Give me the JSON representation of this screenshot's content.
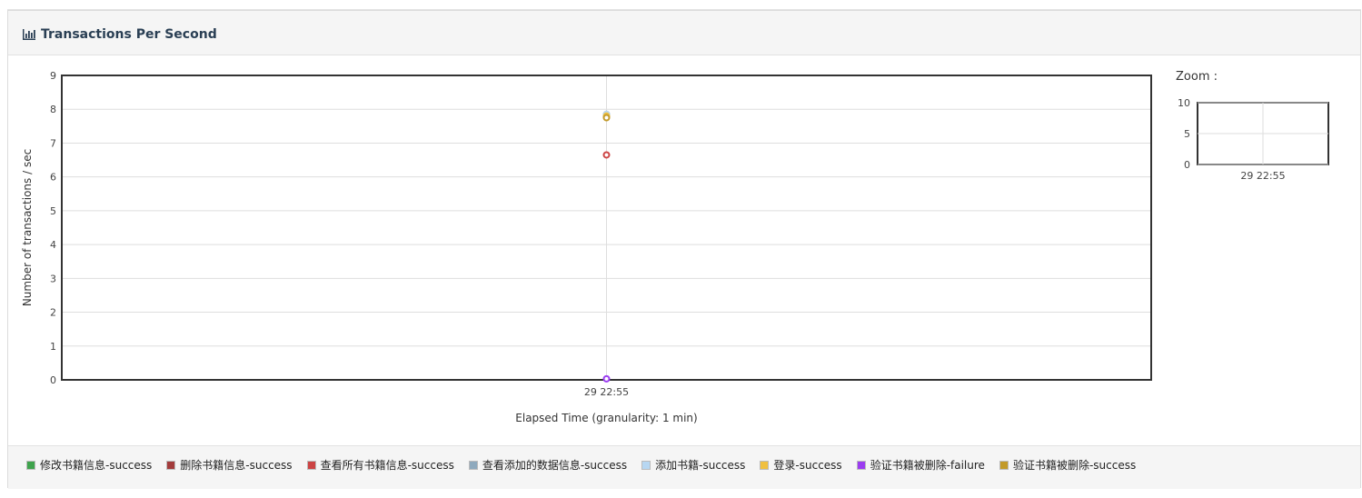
{
  "panel": {
    "title": "Transactions Per Second"
  },
  "zoom": {
    "label": "Zoom :",
    "y_ticks": [
      "10",
      "5",
      "0"
    ],
    "x_tick": "29 22:55",
    "ylim": [
      0,
      10
    ]
  },
  "chart_data": {
    "type": "scatter",
    "title": "",
    "xlabel": "Elapsed Time (granularity: 1 min)",
    "ylabel": "Number of transactions / sec",
    "ylim": [
      0,
      9
    ],
    "y_ticks": [
      0,
      1,
      2,
      3,
      4,
      5,
      6,
      7,
      8,
      9
    ],
    "x_ticks": [
      "29 22:55"
    ],
    "grid": true,
    "legend_position": "bottom",
    "series": [
      {
        "name": "修改书籍信息-success",
        "color": "#3fa34d",
        "x": "29 22:55",
        "y": 7.8
      },
      {
        "name": "删除书籍信息-success",
        "color": "#a33c3c",
        "x": "29 22:55",
        "y": 7.8
      },
      {
        "name": "查看所有书籍信息-success",
        "color": "#cc4444",
        "x": "29 22:55",
        "y": 6.65
      },
      {
        "name": "查看添加的数据信息-success",
        "color": "#8ea9bd",
        "x": "29 22:55",
        "y": 7.85
      },
      {
        "name": "添加书籍-success",
        "color": "#b7d7f2",
        "x": "29 22:55",
        "y": 7.85
      },
      {
        "name": "登录-success",
        "color": "#f0c040",
        "x": "29 22:55",
        "y": 7.8
      },
      {
        "name": "验证书籍被删除-failure",
        "color": "#9b3df0",
        "x": "29 22:55",
        "y": 0.03
      },
      {
        "name": "验证书籍被删除-success",
        "color": "#c29a2a",
        "x": "29 22:55",
        "y": 7.75
      }
    ]
  }
}
